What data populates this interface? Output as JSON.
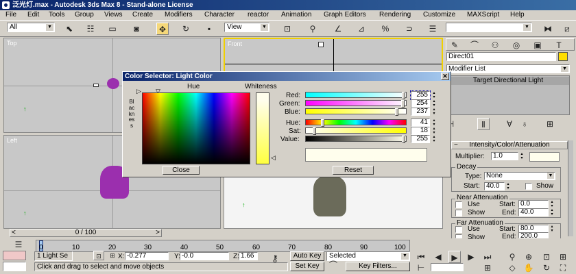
{
  "window": {
    "title": "泛光灯.max - Autodesk 3ds Max 8 - Stand-alone License"
  },
  "menu": [
    "File",
    "Edit",
    "Tools",
    "Group",
    "Views",
    "Create",
    "Modifiers",
    "Character",
    "reactor",
    "Animation",
    "Graph Editors",
    "Rendering",
    "Customize",
    "MAXScript",
    "Help"
  ],
  "toolbar": {
    "selection_filter": "All",
    "ref_coord": "View"
  },
  "viewports": {
    "top": "Top",
    "front": "Front",
    "left": "Left"
  },
  "dialog": {
    "title": "Color Selector: Light Color",
    "hue_label": "Hue",
    "whiteness_label": "Whiteness",
    "blackness_label": "Blackness",
    "rows": [
      {
        "label": "Red:",
        "value": "255",
        "fill": 1.0
      },
      {
        "label": "Green:",
        "value": "254",
        "fill": 0.996
      },
      {
        "label": "Blue:",
        "value": "237",
        "fill": 0.93
      },
      {
        "label": "Hue:",
        "value": "41",
        "fill": 0.16
      },
      {
        "label": "Sat:",
        "value": "18",
        "fill": 0.07
      },
      {
        "label": "Value:",
        "value": "255",
        "fill": 1.0
      }
    ],
    "close_label": "Close",
    "reset_label": "Reset",
    "color": "#fffeed"
  },
  "command_panel": {
    "object_name": "Direct01",
    "object_color": "#ffde00",
    "modifier_list": "Modifier List",
    "stack_item": "Target Directional Light",
    "rollout_title": "Intensity/Color/Attenuation",
    "multiplier_label": "Multiplier:",
    "multiplier_value": "1.0",
    "decay_title": "Decay",
    "type_label": "Type:",
    "type_value": "None",
    "start_label": "Start:",
    "decay_start": "40.0",
    "show_label": "Show",
    "near_title": "Near Attenuation",
    "near_use": "Use",
    "near_show": "Show",
    "near_start_label": "Start:",
    "near_start": "0.0",
    "near_end_label": "End:",
    "near_end": "40.0",
    "far_title": "Far Attenuation",
    "far_use": "Use",
    "far_show": "Show",
    "far_start_label": "Start:",
    "far_start": "80.0",
    "far_end_label": "End:",
    "far_end": "200.0"
  },
  "timeline": {
    "frame": "0 / 100",
    "ticks": [
      "0",
      "10",
      "20",
      "30",
      "40",
      "50",
      "60",
      "70",
      "80",
      "90",
      "100"
    ]
  },
  "status": {
    "selection": "1 Light Se",
    "x_label": "X:",
    "x_value": "-0.277",
    "y_label": "Y:",
    "y_value": "-0.0",
    "z_label": "Z:",
    "z_value": "1.66",
    "prompt": "Click and drag to select and move objects",
    "auto_key": "Auto Key",
    "set_key": "Set Key",
    "selected": "Selected",
    "key_filters": "Key Filters..."
  }
}
